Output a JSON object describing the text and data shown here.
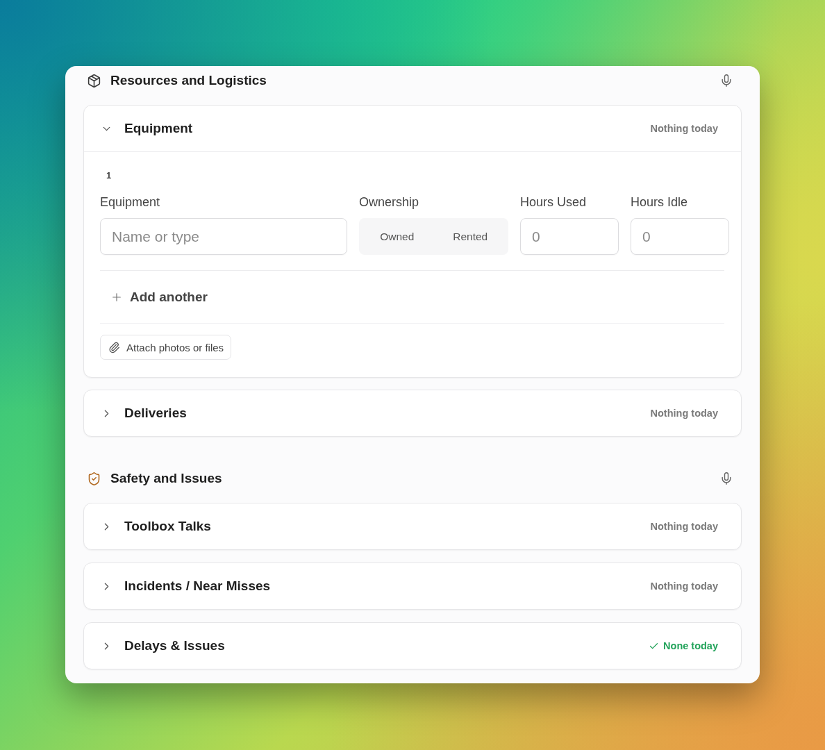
{
  "sections": [
    {
      "title": "Resources and Logistics",
      "items": [
        {
          "title": "Equipment",
          "expanded": true,
          "status": {
            "kind": "empty",
            "text": "Nothing today"
          },
          "entries": [
            {
              "number": "1",
              "fields": [
                {
                  "kind": "text",
                  "label": "Equipment",
                  "placeholder": "Name or type"
                },
                {
                  "kind": "segmented",
                  "label": "Ownership",
                  "options": [
                    {
                      "label": "Owned",
                      "selected": false
                    },
                    {
                      "label": "Rented",
                      "selected": false
                    }
                  ]
                },
                {
                  "kind": "number",
                  "label": "Hours Used",
                  "placeholder": "0"
                },
                {
                  "kind": "number",
                  "label": "Hours Idle",
                  "placeholder": "0"
                }
              ]
            }
          ],
          "add_label": "Add another",
          "attach_label": "Attach photos or files"
        },
        {
          "title": "Deliveries",
          "expanded": false,
          "status": {
            "kind": "empty",
            "text": "Nothing today"
          }
        }
      ]
    },
    {
      "title": "Safety and Issues",
      "items": [
        {
          "title": "Toolbox Talks",
          "expanded": false,
          "status": {
            "kind": "empty",
            "text": "Nothing today"
          }
        },
        {
          "title": "Incidents / Near Misses",
          "expanded": false,
          "status": {
            "kind": "empty",
            "text": "Nothing today"
          }
        },
        {
          "title": "Delays & Issues",
          "expanded": false,
          "status": {
            "kind": "done",
            "text": "None today"
          }
        }
      ]
    }
  ]
}
